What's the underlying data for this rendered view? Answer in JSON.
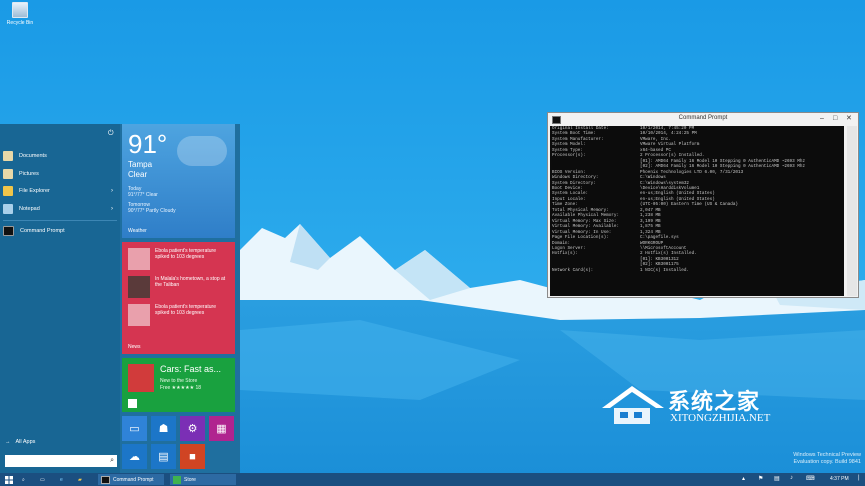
{
  "desktop": {
    "recycle_bin_label": "Recycle Bin",
    "eval_line1": "Windows Technical Preview",
    "eval_line2": "Evaluation copy. Build 9841",
    "watermark_cn": "系统之家",
    "watermark_url": "XITONGZHIJIA.NET"
  },
  "start_menu": {
    "items": [
      {
        "label": "Documents",
        "icon": "documents-icon"
      },
      {
        "label": "Pictures",
        "icon": "pictures-icon"
      },
      {
        "label": "File Explorer",
        "icon": "folder-icon"
      },
      {
        "label": "Notepad",
        "icon": "notepad-icon"
      },
      {
        "label": "Command Prompt",
        "icon": "cmd-icon"
      }
    ],
    "all_apps": "All Apps",
    "search_icon": "search-icon",
    "weather": {
      "temp": "91°",
      "city": "Tampa",
      "cond": "Clear",
      "today_label": "Today",
      "today_value": "91°/77° Clear",
      "tomorrow_label": "Tomorrow",
      "tomorrow_value": "90°/77° Partly Cloudy",
      "name": "Weather"
    },
    "news": {
      "items": [
        "Ebola patient's temperature spiked to 103 degrees",
        "In Malala's hometown, a stop at the Taliban",
        "Ebola patient's temperature spiked to 103 degrees"
      ],
      "name": "News"
    },
    "store": {
      "title": "Cars: Fast as...",
      "sub1": "New to the Store",
      "sub2": "Free ★★★★★ 18"
    },
    "small_tiles": [
      {
        "icon": "desktop-icon",
        "color": "#2f83d8"
      },
      {
        "icon": "people-icon",
        "color": "#1c76c8"
      },
      {
        "icon": "settings-icon",
        "color": "#7b2fb5"
      },
      {
        "icon": "photos-icon",
        "color": "#b0248f"
      },
      {
        "icon": "onedrive-icon",
        "color": "#1c76c8"
      },
      {
        "icon": "reading-list-icon",
        "color": "#1c76c8"
      },
      {
        "icon": "app-icon",
        "color": "#d04423"
      }
    ]
  },
  "cmd": {
    "title": "Command Prompt",
    "lines": [
      [
        "Original Install Date:",
        "10/1/2014, 7:45:20 PM"
      ],
      [
        "System Boot Time:",
        "10/10/2014, 4:24:25 PM"
      ],
      [
        "System Manufacturer:",
        "VMware, Inc."
      ],
      [
        "System Model:",
        "VMware Virtual Platform"
      ],
      [
        "System Type:",
        "x64-based PC"
      ],
      [
        "Processor(s):",
        "2 Processor(s) Installed."
      ],
      [
        "",
        "[01]: AMD64 Family 16 Model 10 Stepping 0 AuthenticAMD ~2693 Mhz"
      ],
      [
        "",
        "[02]: AMD64 Family 16 Model 10 Stepping 0 AuthenticAMD ~2693 Mhz"
      ],
      [
        "BIOS Version:",
        "Phoenix Technologies LTD 6.00, 7/31/2013"
      ],
      [
        "Windows Directory:",
        "C:\\Windows"
      ],
      [
        "System Directory:",
        "C:\\Windows\\system32"
      ],
      [
        "Boot Device:",
        "\\Device\\HarddiskVolume1"
      ],
      [
        "System Locale:",
        "en-us;English (United States)"
      ],
      [
        "Input Locale:",
        "en-us;English (United States)"
      ],
      [
        "Time Zone:",
        "(UTC-05:00) Eastern Time (US & Canada)"
      ],
      [
        "Total Physical Memory:",
        "2,047 MB"
      ],
      [
        "Available Physical Memory:",
        "1,238 MB"
      ],
      [
        "Virtual Memory: Max Size:",
        "3,199 MB"
      ],
      [
        "Virtual Memory: Available:",
        "1,875 MB"
      ],
      [
        "Virtual Memory: In Use:",
        "1,324 MB"
      ],
      [
        "Page File Location(s):",
        "C:\\pagefile.sys"
      ],
      [
        "Domain:",
        "WORKGROUP"
      ],
      [
        "Logon Server:",
        "\\\\MicrosoftAccount"
      ],
      [
        "Hotfix(s):",
        "2 Hotfix(s) Installed."
      ],
      [
        "",
        "[01]: KB3001312"
      ],
      [
        "",
        "[02]: KB3001175"
      ],
      [
        "Network Card(s):",
        "1 NIC(s) Installed."
      ]
    ]
  },
  "taskbar": {
    "items": [
      {
        "label": "",
        "icon": "search-icon"
      },
      {
        "label": "",
        "icon": "task-view-icon"
      },
      {
        "label": "",
        "icon": "ie-icon"
      },
      {
        "label": "",
        "icon": "folder-icon"
      },
      {
        "label": "",
        "icon": "store-icon"
      },
      {
        "label": "Command Prompt",
        "icon": "cmd-icon"
      },
      {
        "label": "Store",
        "icon": "store-icon"
      }
    ],
    "time": "4:37 PM"
  }
}
